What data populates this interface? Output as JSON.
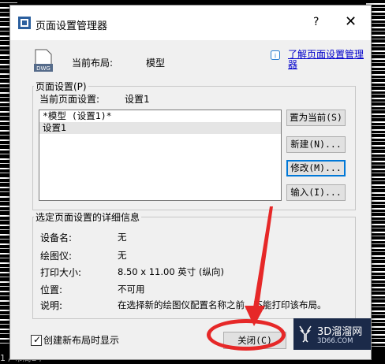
{
  "dialog": {
    "title": "页面设置管理器",
    "help_btn": "?",
    "close_btn": "✕"
  },
  "layout": {
    "label": "当前布局:",
    "value": "模型",
    "icon_text": "DWG",
    "help_link": "了解页面设置管理器"
  },
  "page_setup": {
    "group_title": "页面设置(P)",
    "current_label": "当前页面设置:",
    "current_value": "设置1",
    "items": [
      "*模型 (设置1)*",
      "设置1"
    ],
    "buttons": [
      "置为当前(S)",
      "新建(N)...",
      "修改(M)...",
      "输入(I)..."
    ]
  },
  "details": {
    "group_title": "选定页面设置的详细信息",
    "rows": [
      {
        "label": "设备名:",
        "value": "无"
      },
      {
        "label": "绘图仪:",
        "value": "无"
      },
      {
        "label": "打印大小:",
        "value": "8.50 x 11.00 英寸 (纵向)"
      },
      {
        "label": "位置:",
        "value": "不可用"
      },
      {
        "label": "说明:",
        "value": "在选择新的绘图仪配置名称之前，不能打印该布局。"
      }
    ]
  },
  "footer": {
    "checkbox_label": "创建新布局时显示",
    "checkbox_checked": true,
    "close_label": "关闭(C)"
  },
  "background": {
    "tabs_text": "1 / 布局2 /"
  },
  "watermark": {
    "main": "3D溜溜网",
    "sub": "3D66.COM"
  },
  "colors": {
    "accent": "#0078d7",
    "annotation": "#e62828",
    "link": "#0000cc"
  }
}
